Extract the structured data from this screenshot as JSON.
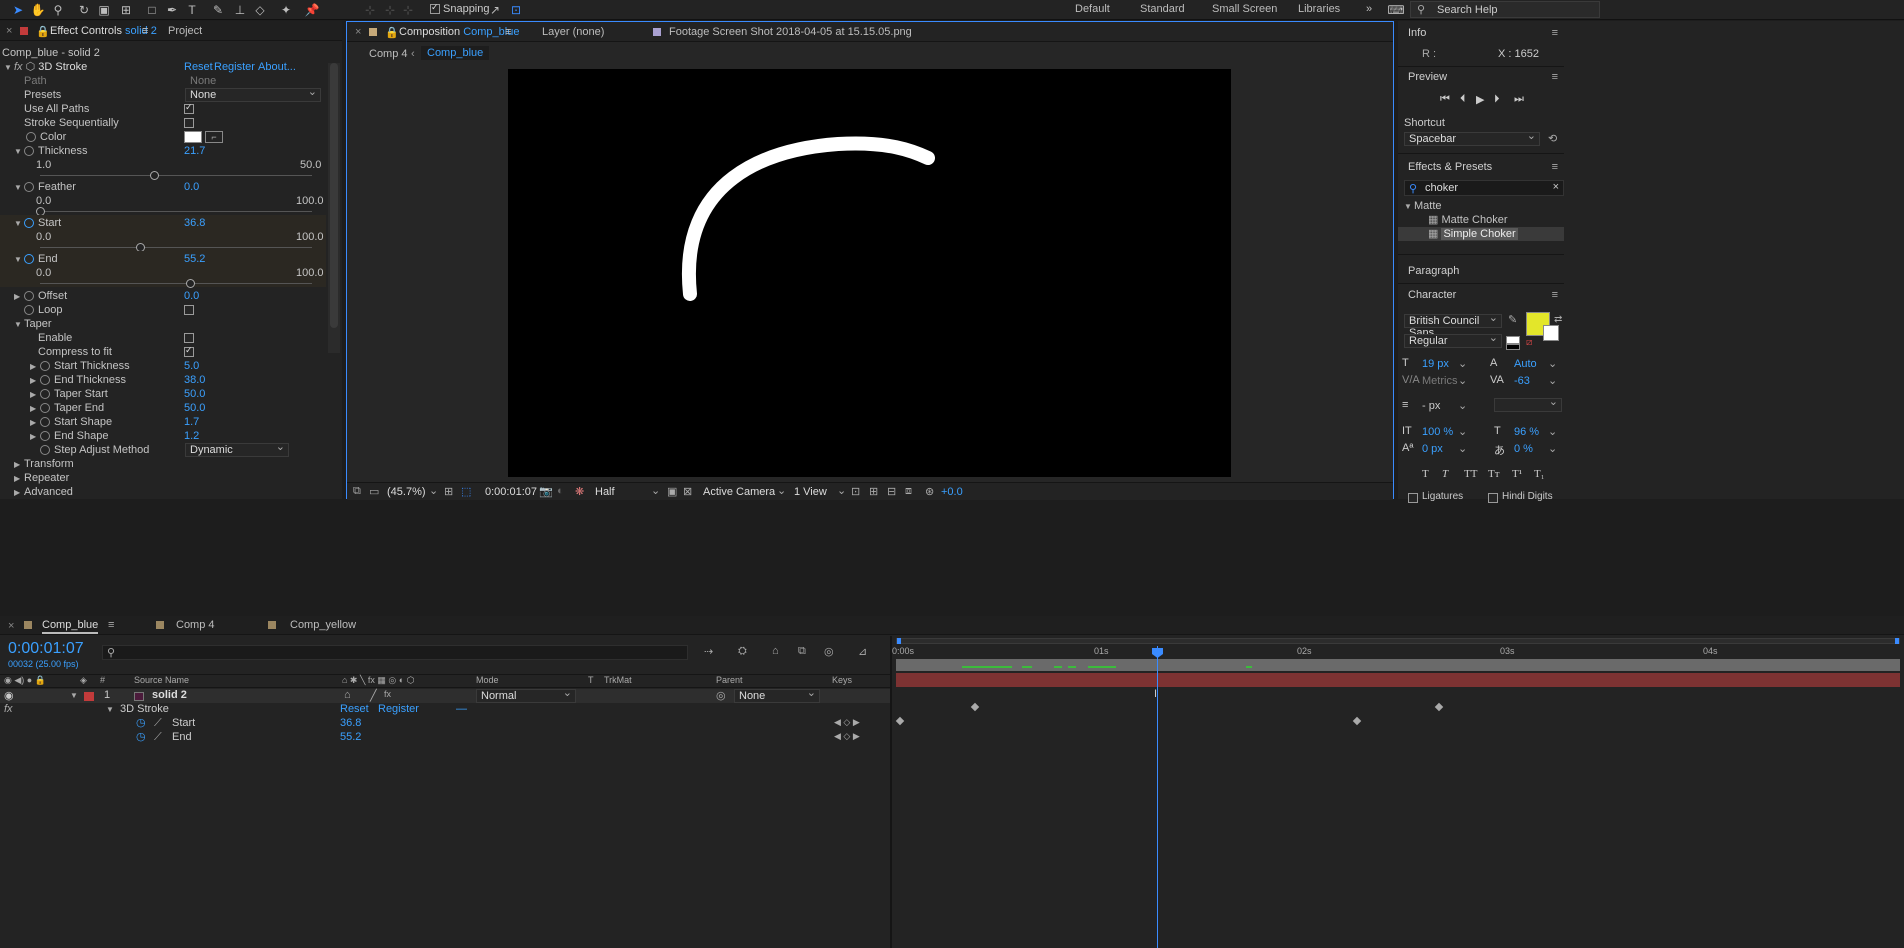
{
  "toolbar": {
    "snapping_label": "Snapping",
    "workspaces": [
      "Default",
      "Standard",
      "Small Screen",
      "Libraries"
    ],
    "more_label": "»",
    "search_placeholder": "Search Help"
  },
  "effect_controls": {
    "tab_label": "Effect Controls",
    "tab_layer": "solid 2",
    "project_tab": "Project",
    "subtitle": "Comp_blue - solid 2",
    "effect_name": "3D Stroke",
    "reset": "Reset",
    "register": "Register",
    "about": "About...",
    "path_label": "Path",
    "path_value": "None",
    "presets_label": "Presets",
    "presets_value": "None",
    "use_all_paths": "Use All Paths",
    "stroke_seq": "Stroke Sequentially",
    "color_label": "Color",
    "thickness_label": "Thickness",
    "thickness_value": "21.7",
    "thickness_min": "1.0",
    "thickness_max": "50.0",
    "thickness_level": 0.42,
    "feather_label": "Feather",
    "feather_value": "0.0",
    "feather_min": "0.0",
    "feather_max": "100.0",
    "feather_level": 0.0,
    "start_label": "Start",
    "start_value": "36.8",
    "start_min": "0.0",
    "start_max": "100.0",
    "start_level": 0.368,
    "end_label": "End",
    "end_value": "55.2",
    "end_min": "0.0",
    "end_max": "100.0",
    "end_level": 0.552,
    "offset_label": "Offset",
    "offset_value": "0.0",
    "loop_label": "Loop",
    "taper_label": "Taper",
    "enable_label": "Enable",
    "compress_label": "Compress to fit",
    "taper_rows": [
      {
        "label": "Start Thickness",
        "value": "5.0"
      },
      {
        "label": "End Thickness",
        "value": "38.0"
      },
      {
        "label": "Taper Start",
        "value": "50.0"
      },
      {
        "label": "Taper End",
        "value": "50.0"
      },
      {
        "label": "Start Shape",
        "value": "1.7"
      },
      {
        "label": "End Shape",
        "value": "1.2"
      }
    ],
    "step_adjust_label": "Step Adjust Method",
    "step_adjust_value": "Dynamic",
    "transform_label": "Transform",
    "repeater_label": "Repeater",
    "advanced_label": "Advanced"
  },
  "composition": {
    "tab_prefix": "Composition",
    "tab_name": "Comp_blue",
    "layer_tab": "Layer (none)",
    "footage_tab": "Footage Screen Shot 2018-04-05 at 15.15.05.png",
    "breadcrumb_1": "Comp 4",
    "breadcrumb_2": "Comp_blue",
    "zoom": "(45.7%)",
    "timecode": "0:00:01:07",
    "resolution": "Half",
    "camera": "Active Camera",
    "view": "1 View",
    "exposure": "+0.0",
    "stroke_color": "#ffffff"
  },
  "right_panel": {
    "info_title": "Info",
    "info_r": "R :",
    "info_x": "X : 1652",
    "preview_title": "Preview",
    "shortcut_label": "Shortcut",
    "shortcut_value": "Spacebar",
    "effects_title": "Effects & Presets",
    "effects_search": "choker",
    "matte_group": "Matte",
    "matte_items": [
      "Matte Choker",
      "Simple Choker"
    ],
    "paragraph_title": "Paragraph",
    "character_title": "Character",
    "font_family": "British Council Sans",
    "font_style": "Regular",
    "font_size": "19 px",
    "leading": "Auto",
    "kerning": "Metrics",
    "tracking": "-63",
    "stroke_width": "- px",
    "vert_scale": "100 %",
    "horiz_scale": "96 %",
    "baseline": "0 px",
    "tsume": "0 %",
    "ligatures": "Ligatures",
    "hindi_digits": "Hindi Digits",
    "fill_color": "#e3e62a",
    "type_buttons": [
      "T",
      "T",
      "TT",
      "Tт",
      "T¹",
      "T₁"
    ]
  },
  "timeline": {
    "tabs": [
      "Comp_blue",
      "Comp 4",
      "Comp_yellow"
    ],
    "tab_colors": [
      "#9b8660",
      "#9b8660",
      "#9b8660"
    ],
    "timecode": "0:00:01:07",
    "frames_info": "00032 (25.00 fps)",
    "search_placeholder": "",
    "col_source": "Source Name",
    "col_mode": "Mode",
    "col_t": "T",
    "col_trkmat": "TrkMat",
    "col_parent": "Parent",
    "col_keys": "Keys",
    "layer_num": "1",
    "layer_name": "solid 2",
    "layer_mode": "Normal",
    "layer_parent": "None",
    "effect_name": "3D Stroke",
    "reset": "Reset",
    "register": "Register",
    "start_label": "Start",
    "start_value": "36.8",
    "end_label": "End",
    "end_value": "55.2",
    "ruler": [
      "0:00s",
      "01s",
      "02s",
      "03s",
      "04s"
    ],
    "layer_bar_color": "#7d3232"
  }
}
